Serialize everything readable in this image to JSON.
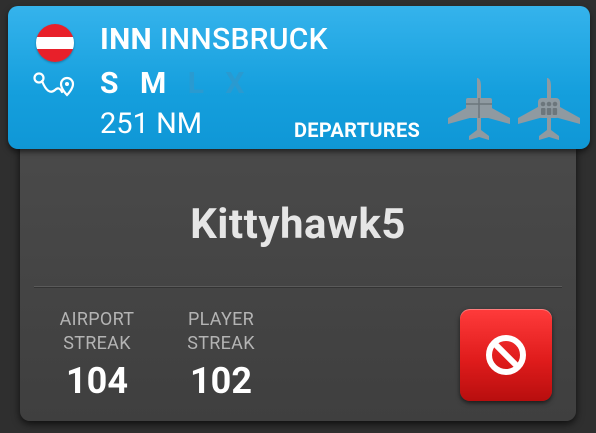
{
  "header": {
    "airport_code": "INN",
    "airport_name": "INNSBRUCK",
    "sizes": [
      {
        "label": "S",
        "active": true
      },
      {
        "label": "M",
        "active": true
      },
      {
        "label": "L",
        "active": false
      },
      {
        "label": "X",
        "active": false
      }
    ],
    "distance": "251 NM",
    "mode": "DEPARTURES",
    "flag_country": "Austria",
    "icons": [
      "austria-flag-icon",
      "route-icon",
      "cargo-plane-icon",
      "passenger-plane-icon"
    ]
  },
  "card": {
    "player_name": "Kittyhawk5",
    "airport_streak_label": "AIRPORT\nSTREAK",
    "airport_streak_value": "104",
    "player_streak_label": "PLAYER\nSTREAK",
    "player_streak_value": "102",
    "cancel_icon": "prohibited-icon"
  },
  "colors": {
    "header_blue": "#1aa3e0",
    "card_gray": "#454545",
    "background": "#2f2f2f",
    "cancel_red": "#e51e1e",
    "size_inactive": "#2a9ad0"
  }
}
